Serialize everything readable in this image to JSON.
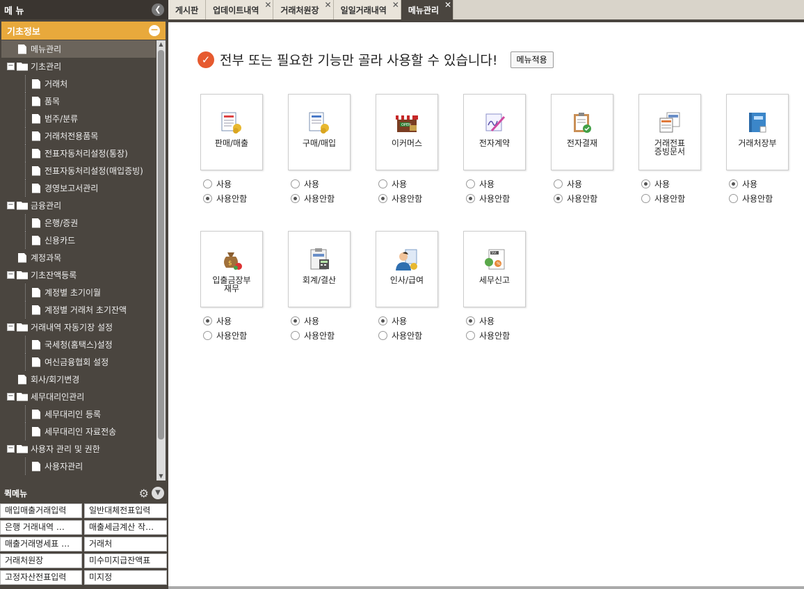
{
  "sidebar": {
    "title": "메 뉴",
    "section": "기초정보",
    "tree": [
      {
        "label": "메뉴관리",
        "level": 1,
        "type": "doc",
        "selected": true
      },
      {
        "label": "기초관리",
        "level": 0,
        "type": "folder"
      },
      {
        "label": "거래처",
        "level": 2,
        "type": "doc"
      },
      {
        "label": "품목",
        "level": 2,
        "type": "doc"
      },
      {
        "label": "범주/분류",
        "level": 2,
        "type": "doc"
      },
      {
        "label": "거래처전용품목",
        "level": 2,
        "type": "doc"
      },
      {
        "label": "전표자동처리설정(통장)",
        "level": 2,
        "type": "doc"
      },
      {
        "label": "전표자동처리설정(매입증빙)",
        "level": 2,
        "type": "doc"
      },
      {
        "label": "경영보고서관리",
        "level": 2,
        "type": "doc"
      },
      {
        "label": "금융관리",
        "level": 0,
        "type": "folder"
      },
      {
        "label": "은행/증권",
        "level": 2,
        "type": "doc"
      },
      {
        "label": "신용카드",
        "level": 2,
        "type": "doc"
      },
      {
        "label": "계정과목",
        "level": 1,
        "type": "doc"
      },
      {
        "label": "기초잔액등록",
        "level": 0,
        "type": "folder"
      },
      {
        "label": "계정별 초기이월",
        "level": 2,
        "type": "doc"
      },
      {
        "label": "계정별 거래처 초기잔액",
        "level": 2,
        "type": "doc"
      },
      {
        "label": "거래내역 자동기장 설정",
        "level": 0,
        "type": "folder"
      },
      {
        "label": "국세청(홈택스)설정",
        "level": 2,
        "type": "doc"
      },
      {
        "label": "여신금융협회 설정",
        "level": 2,
        "type": "doc"
      },
      {
        "label": "회사/회기변경",
        "level": 1,
        "type": "doc"
      },
      {
        "label": "세무대리인관리",
        "level": 0,
        "type": "folder"
      },
      {
        "label": "세무대리인 등록",
        "level": 2,
        "type": "doc"
      },
      {
        "label": "세무대리인 자료전송",
        "level": 2,
        "type": "doc"
      },
      {
        "label": "사용자 관리 및 권한",
        "level": 0,
        "type": "folder"
      },
      {
        "label": "사용자관리",
        "level": 2,
        "type": "doc"
      }
    ],
    "quick_title": "퀵메뉴",
    "quick": [
      "매입매출거래입력",
      "일반대체전표입력",
      "은행 거래내역 …",
      "매출세금계산 작…",
      "매출거래명세표 …",
      "거래처",
      "거래처원장",
      "미수미지급잔액표",
      "고정자산전표입력",
      "미지정"
    ]
  },
  "tabs": [
    {
      "label": "게시판",
      "closable": false
    },
    {
      "label": "업데이트내역",
      "closable": true
    },
    {
      "label": "거래처원장",
      "closable": true
    },
    {
      "label": "일일거래내역",
      "closable": true
    },
    {
      "label": "메뉴관리",
      "closable": true,
      "active": true
    }
  ],
  "main": {
    "headline": "전부 또는 필요한 기능만 골라 사용할 수 있습니다!",
    "apply_label": "메뉴적용",
    "use_label": "사용",
    "nouse_label": "사용안함",
    "modules": [
      {
        "label": "판매/매출",
        "icon": "sales-icon",
        "use": false
      },
      {
        "label": "구매/매입",
        "icon": "purchase-icon",
        "use": false
      },
      {
        "label": "이커머스",
        "icon": "shop-icon",
        "use": false
      },
      {
        "label": "전자계약",
        "icon": "signature-icon",
        "use": false
      },
      {
        "label": "전자결재",
        "icon": "clipboard-approval-icon",
        "use": false
      },
      {
        "label": "거래전표\n증빙문서",
        "icon": "documents-icon",
        "use": true
      },
      {
        "label": "거래처장부",
        "icon": "ledger-book-icon",
        "use": true
      },
      {
        "label": "입출금장부\n재무",
        "icon": "money-bag-icon",
        "use": true
      },
      {
        "label": "회계/결산",
        "icon": "accounting-calculator-icon",
        "use": true
      },
      {
        "label": "인사/급여",
        "icon": "person-payroll-icon",
        "use": true
      },
      {
        "label": "세무신고",
        "icon": "tax-report-icon",
        "use": true
      }
    ]
  }
}
